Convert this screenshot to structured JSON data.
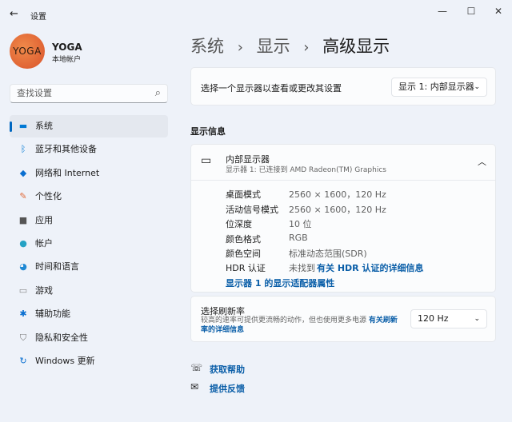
{
  "window": {
    "title": "设置",
    "back": "←",
    "min": "—",
    "max": "☐",
    "close": "✕"
  },
  "user": {
    "avatar_text": "YOGA",
    "name": "YOGA",
    "account": "本地帐户"
  },
  "search": {
    "placeholder": "查找设置",
    "icon": "⌕"
  },
  "nav": [
    {
      "label": "系统",
      "icon": "▬",
      "color": "#0078d4"
    },
    {
      "label": "蓝牙和其他设备",
      "icon": "ᛒ",
      "color": "#0078d4"
    },
    {
      "label": "网络和 Internet",
      "icon": "◆",
      "color": "#0a6fd0"
    },
    {
      "label": "个性化",
      "icon": "✎",
      "color": "#e06a3a"
    },
    {
      "label": "应用",
      "icon": "■",
      "color": "#555"
    },
    {
      "label": "帐户",
      "icon": "●",
      "color": "#25a2c4"
    },
    {
      "label": "时间和语言",
      "icon": "◕",
      "color": "#1e88d4"
    },
    {
      "label": "游戏",
      "icon": "▭",
      "color": "#888"
    },
    {
      "label": "辅助功能",
      "icon": "✱",
      "color": "#0a6fd0"
    },
    {
      "label": "隐私和安全性",
      "icon": "⛉",
      "color": "#777"
    },
    {
      "label": "Windows 更新",
      "icon": "↻",
      "color": "#0a6fd0"
    }
  ],
  "breadcrumb": {
    "items": [
      "系统",
      "显示",
      "高级显示"
    ],
    "sep": "›"
  },
  "selector": {
    "label": "选择一个显示器以查看或更改其设置",
    "value": "显示 1: 内部显示器"
  },
  "section_title": "显示信息",
  "display": {
    "name": "内部显示器",
    "subtitle": "显示器 1: 已连接到 AMD Radeon(TM) Graphics",
    "rows": [
      {
        "k": "桌面模式",
        "v": "2560 × 1600，120 Hz"
      },
      {
        "k": "活动信号模式",
        "v": "2560 × 1600，120 Hz"
      },
      {
        "k": "位深度",
        "v": "10 位"
      },
      {
        "k": "颜色格式",
        "v": "RGB"
      },
      {
        "k": "颜色空间",
        "v": "标准动态范围(SDR)"
      }
    ],
    "hdr_label": "HDR 认证",
    "hdr_value": "未找到",
    "hdr_link": "有关 HDR 认证的详细信息",
    "adapter_link": "显示器 1 的显示适配器属性"
  },
  "refresh": {
    "title": "选择刷新率",
    "desc": "较高的速率可提供更流畅的动作，但也使用更多电源",
    "link": "有关刷新率的详细信息",
    "value": "120 Hz"
  },
  "help": {
    "get_help": "获取帮助",
    "feedback": "提供反馈"
  },
  "accent": "#0067c0"
}
